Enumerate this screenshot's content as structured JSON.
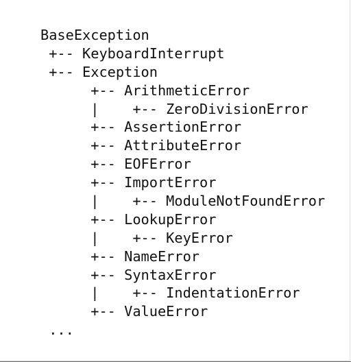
{
  "hierarchy": {
    "lines": [
      {
        "text": "BaseException",
        "name": "node-baseexception"
      },
      {
        "text": " +-- KeyboardInterrupt",
        "name": "node-keyboardinterrupt"
      },
      {
        "text": " +-- Exception",
        "name": "node-exception"
      },
      {
        "text": "      +-- ArithmeticError",
        "name": "node-arithmeticerror"
      },
      {
        "text": "      |    +-- ZeroDivisionError",
        "name": "node-zerodivisionerror"
      },
      {
        "text": "      +-- AssertionError",
        "name": "node-assertionerror"
      },
      {
        "text": "      +-- AttributeError",
        "name": "node-attributeerror"
      },
      {
        "text": "      +-- EOFError",
        "name": "node-eoferror"
      },
      {
        "text": "      +-- ImportError",
        "name": "node-importerror"
      },
      {
        "text": "      |    +-- ModuleNotFoundError",
        "name": "node-modulenotfounderror"
      },
      {
        "text": "      +-- LookupError",
        "name": "node-lookuperror"
      },
      {
        "text": "      |    +-- KeyError",
        "name": "node-keyerror"
      },
      {
        "text": "      +-- NameError",
        "name": "node-nameerror"
      },
      {
        "text": "      +-- SyntaxError",
        "name": "node-syntaxerror"
      },
      {
        "text": "      |    +-- IndentationError",
        "name": "node-indentationerror"
      },
      {
        "text": "      +-- ValueError",
        "name": "node-valueerror"
      },
      {
        "text": " ...",
        "name": "ellipsis"
      }
    ]
  }
}
